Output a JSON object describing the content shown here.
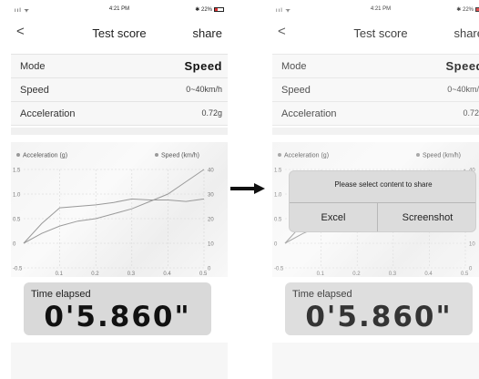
{
  "status": {
    "signal": "ııl ᯤ",
    "time": "4:21 PM",
    "battery": "✱ 22%"
  },
  "nav": {
    "back": "<",
    "title": "Test score",
    "share": "share"
  },
  "rows": [
    {
      "label": "Mode",
      "value": "Speed"
    },
    {
      "label": "Speed",
      "value": "0~40km/h"
    },
    {
      "label": "Acceleration",
      "value": "0.72g"
    }
  ],
  "chart_data": {
    "type": "line",
    "legend": [
      "Acceleration  (g)",
      "Speed  (km/h)"
    ],
    "x": [
      0,
      0.05,
      0.1,
      0.15,
      0.2,
      0.25,
      0.3,
      0.35,
      0.4,
      0.45,
      0.5
    ],
    "xticks": [
      "0.1",
      "0.2",
      "0.3",
      "0.4",
      "0.5"
    ],
    "y_left_ticks": [
      "1.5",
      "1.0",
      "0.5",
      "0",
      "-0.5"
    ],
    "y_right_ticks": [
      "40",
      "30",
      "20",
      "10",
      "0"
    ],
    "ylim_left": [
      -0.5,
      1.5
    ],
    "ylim_right": [
      0,
      40
    ],
    "series": [
      {
        "name": "Acceleration  (g)",
        "axis": "left",
        "values": [
          0.0,
          0.4,
          0.72,
          0.75,
          0.78,
          0.83,
          0.9,
          0.88,
          0.88,
          0.85,
          0.9
        ]
      },
      {
        "name": "Speed  (km/h)",
        "axis": "right",
        "values": [
          10,
          14,
          17,
          19,
          20,
          22,
          24,
          27,
          30,
          35,
          40
        ]
      }
    ],
    "colors": {
      "acceleration": "#999999",
      "speed": "#9a9a9a",
      "grid": "#d6d6d6"
    }
  },
  "time": {
    "label": "Time elapsed",
    "value": "0'5.860\""
  },
  "dialog": {
    "message": "Please select content to share",
    "excel": "Excel",
    "screenshot": "Screenshot"
  }
}
